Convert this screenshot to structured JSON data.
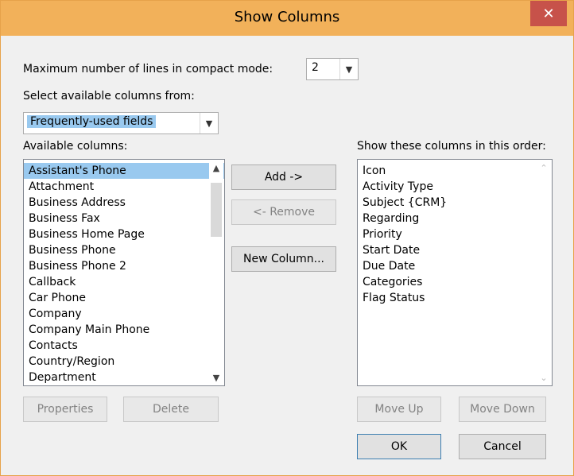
{
  "window": {
    "title": "Show Columns",
    "close_glyph": "✕"
  },
  "compact": {
    "label": "Maximum number of lines in compact mode:",
    "value": "2"
  },
  "source": {
    "label": "Select available columns from:",
    "value": "Frequently-used fields"
  },
  "available": {
    "label": "Available columns:",
    "items": [
      "Assistant's Phone",
      "Attachment",
      "Business Address",
      "Business Fax",
      "Business Home Page",
      "Business Phone",
      "Business Phone 2",
      "Callback",
      "Car Phone",
      "Company",
      "Company Main Phone",
      "Contacts",
      "Country/Region",
      "Department"
    ],
    "selected_index": 0
  },
  "shown": {
    "label": "Show these columns in this order:",
    "items": [
      "Icon",
      "Activity Type",
      "Subject {CRM}",
      "Regarding",
      "Priority",
      "Start Date",
      "Due Date",
      "Categories",
      "Flag Status"
    ]
  },
  "buttons": {
    "add": "Add ->",
    "remove": "<- Remove",
    "new_column": "New Column...",
    "properties": "Properties",
    "delete": "Delete",
    "move_up": "Move Up",
    "move_down": "Move Down",
    "ok": "OK",
    "cancel": "Cancel"
  },
  "icons": {
    "dropdown": "chevron-down",
    "scroll_up": "scroll-up-arrow",
    "scroll_down": "scroll-down-arrow"
  },
  "colors": {
    "titlebar": "#f2b15a",
    "close_button": "#c7524a",
    "selection": "#99c9ef"
  }
}
